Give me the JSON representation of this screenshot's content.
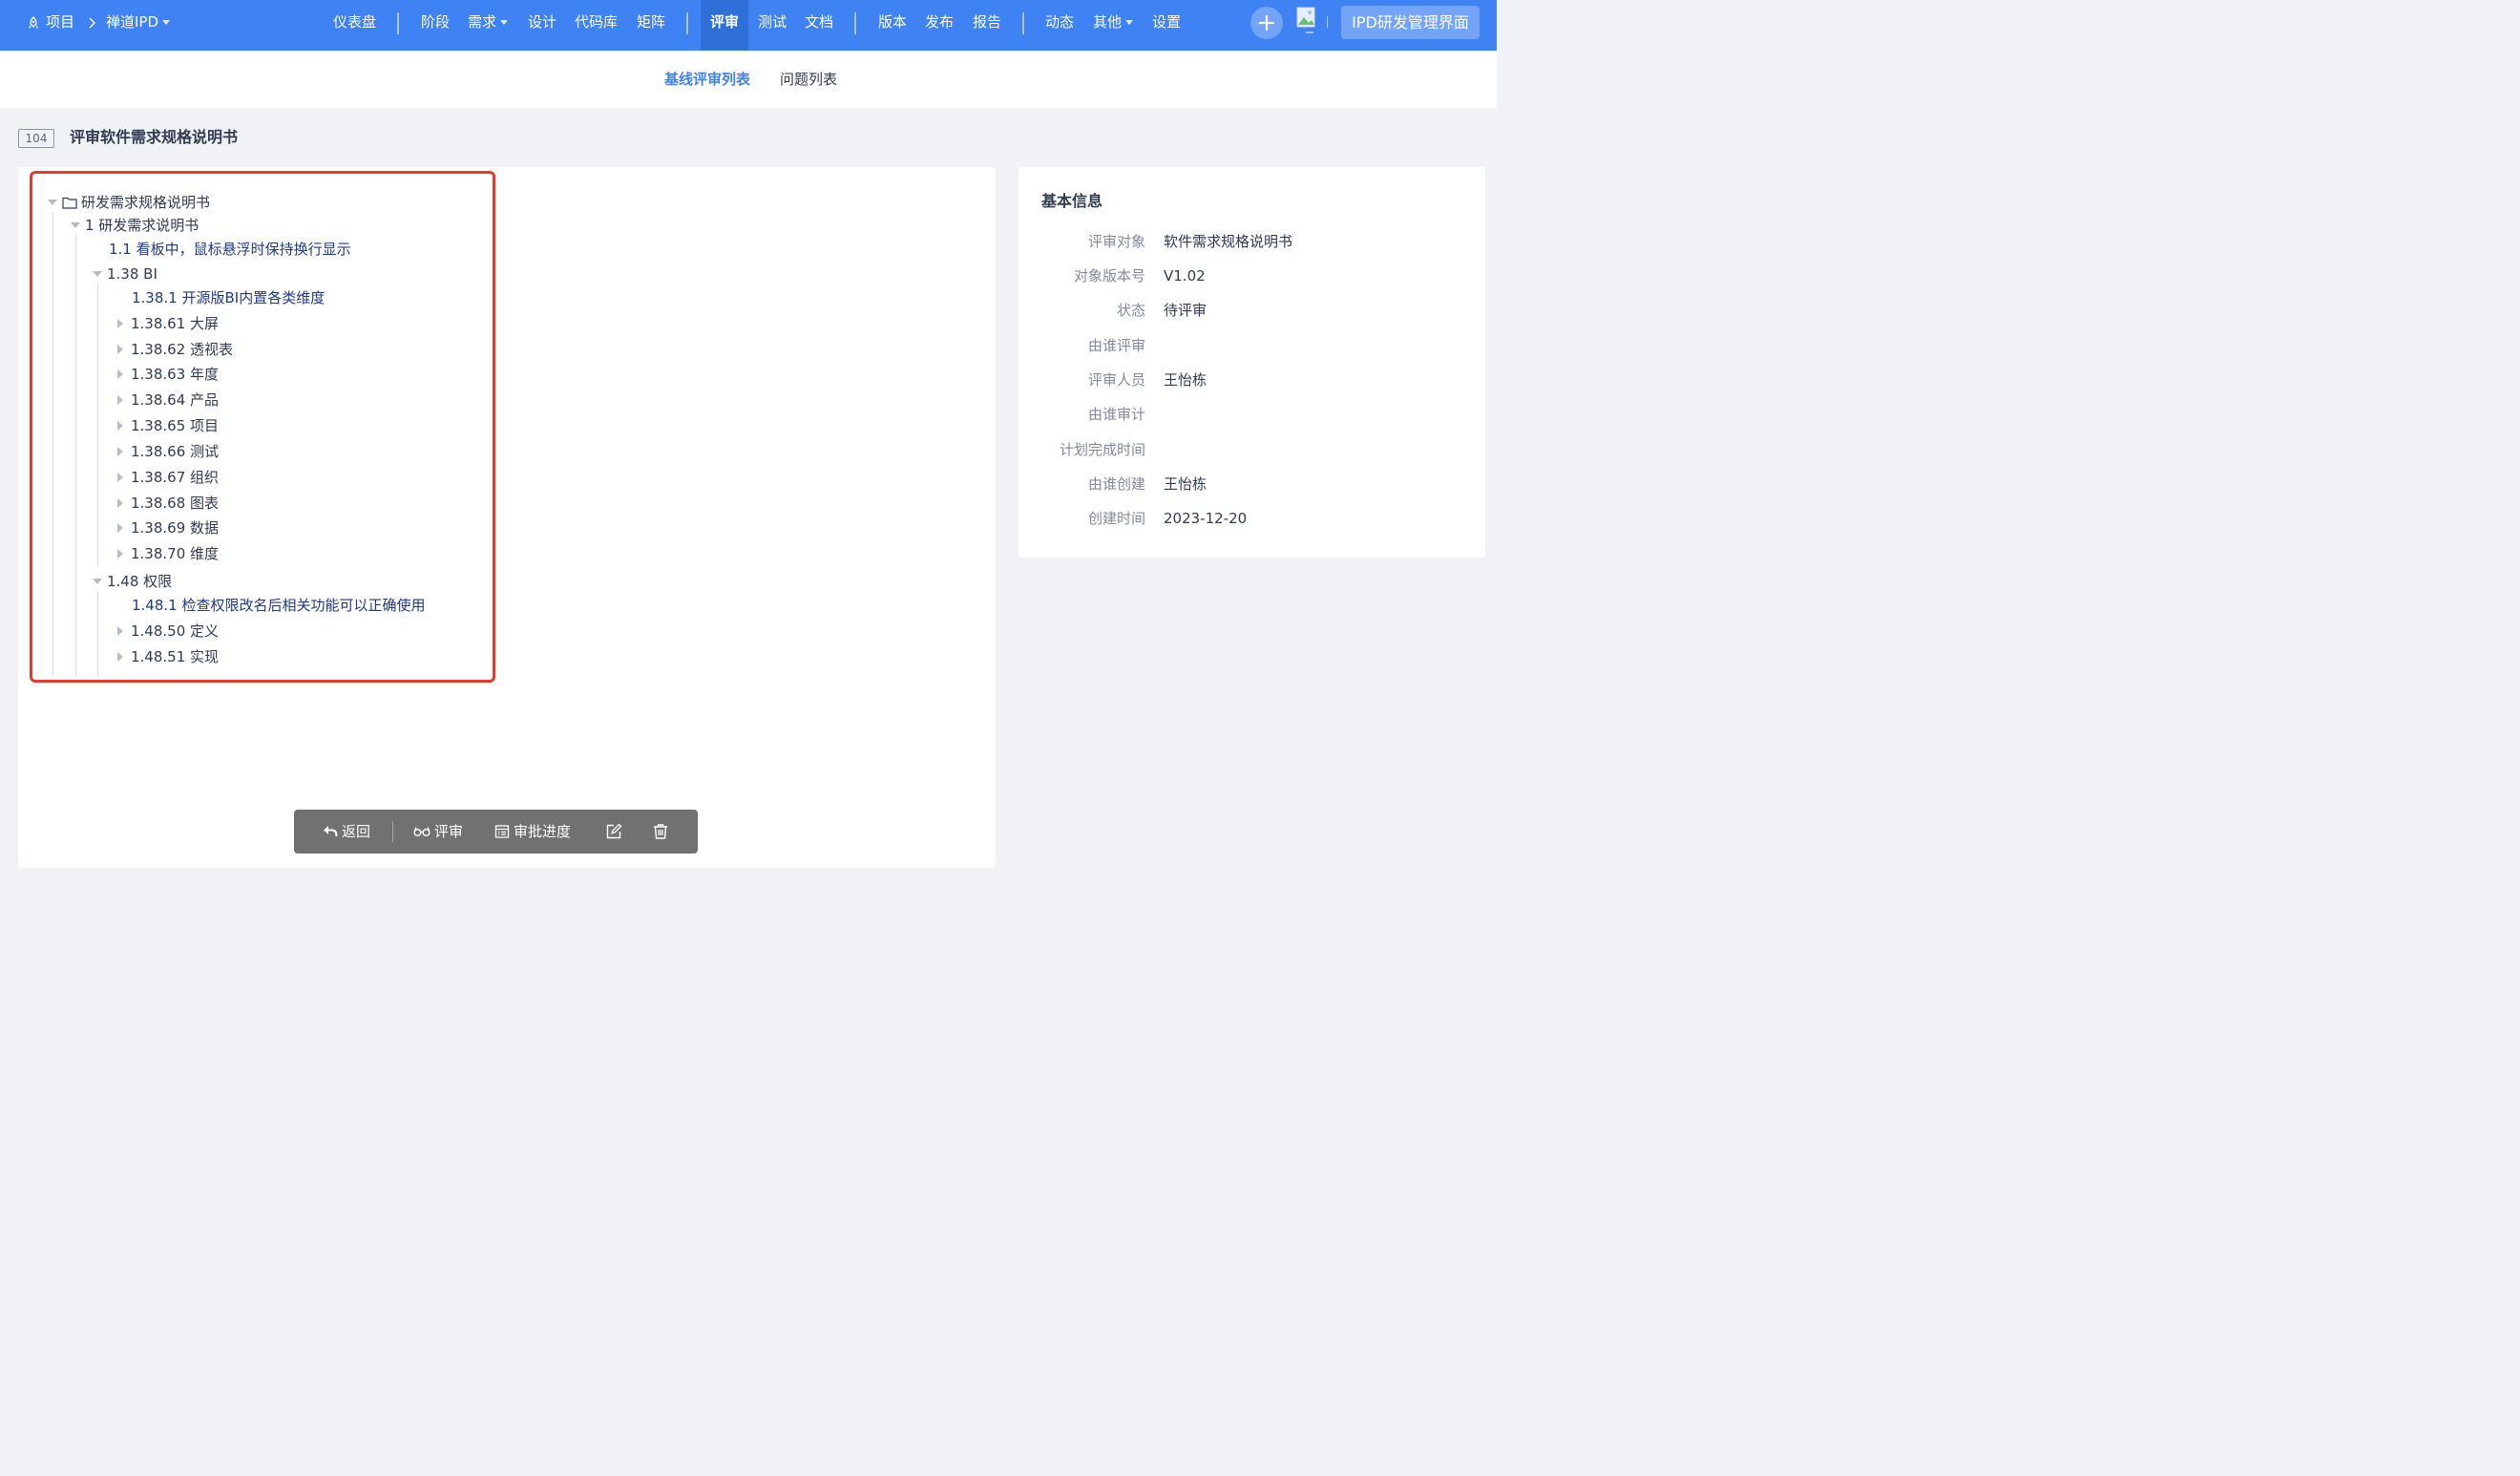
{
  "topnav": {
    "project_label": "项目",
    "product_label": "禅道IPD",
    "items": [
      {
        "label": "仪表盘",
        "active": false
      },
      {
        "label": "阶段",
        "active": false
      },
      {
        "label": "需求",
        "active": false,
        "dropdown": true
      },
      {
        "label": "设计",
        "active": false
      },
      {
        "label": "代码库",
        "active": false
      },
      {
        "label": "矩阵",
        "active": false
      },
      {
        "label": "评审",
        "active": true
      },
      {
        "label": "测试",
        "active": false
      },
      {
        "label": "文档",
        "active": false
      },
      {
        "label": "版本",
        "active": false
      },
      {
        "label": "发布",
        "active": false
      },
      {
        "label": "报告",
        "active": false
      },
      {
        "label": "动态",
        "active": false
      },
      {
        "label": "其他",
        "active": false,
        "dropdown": true
      },
      {
        "label": "设置",
        "active": false
      }
    ],
    "brand_button": "IPD研发管理界面"
  },
  "subnav": {
    "tabs": [
      {
        "label": "基线评审列表",
        "active": true
      },
      {
        "label": "问题列表",
        "active": false
      }
    ]
  },
  "header": {
    "id": "104",
    "title": "评审软件需求规格说明书"
  },
  "tree": {
    "root": "研发需求规格说明书",
    "level1": "1 研发需求说明书",
    "item_1_1": "1.1 看板中，鼠标悬浮时保持换行显示",
    "bi": {
      "label": "1.38 BI",
      "first": "1.38.1 开源版BI内置各类维度",
      "children": [
        "1.38.61 大屏",
        "1.38.62 透视表",
        "1.38.63 年度",
        "1.38.64 产品",
        "1.38.65 项目",
        "1.38.66 测试",
        "1.38.67 组织",
        "1.38.68 图表",
        "1.38.69 数据",
        "1.38.70 维度"
      ]
    },
    "perm": {
      "label": "1.48 权限",
      "first": "1.48.1 检查权限改名后相关功能可以正确使用",
      "children": [
        "1.48.50 定义",
        "1.48.51 实现"
      ]
    }
  },
  "toolbar": {
    "back": "返回",
    "review": "评审",
    "approval": "审批进度"
  },
  "basic_info": {
    "title": "基本信息",
    "fields": [
      {
        "label": "评审对象",
        "value": "软件需求规格说明书"
      },
      {
        "label": "对象版本号",
        "value": "V1.02"
      },
      {
        "label": "状态",
        "value": "待评审"
      },
      {
        "label": "由谁评审",
        "value": ""
      },
      {
        "label": "评审人员",
        "value": "王怡栋"
      },
      {
        "label": "由谁审计",
        "value": ""
      },
      {
        "label": "计划完成时间",
        "value": ""
      },
      {
        "label": "由谁创建",
        "value": "王怡栋"
      },
      {
        "label": "创建时间",
        "value": "2023-12-20"
      }
    ]
  },
  "colors": {
    "primary": "#3e82f4",
    "highlight_border": "#e8392c",
    "toolbar_bg": "#717171"
  }
}
